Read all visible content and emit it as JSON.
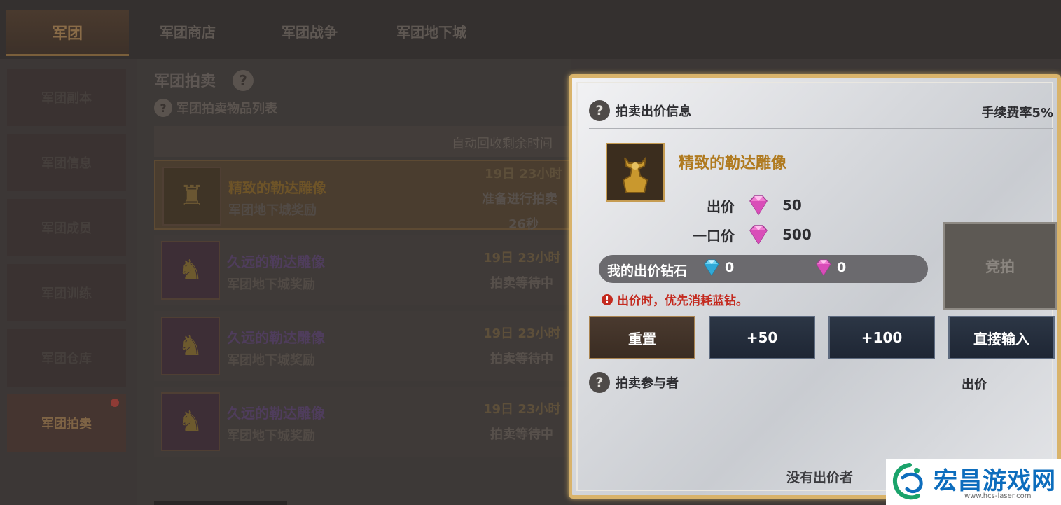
{
  "top_tabs": {
    "main": "军团",
    "shop": "军团商店",
    "war": "军团战争",
    "dungeon": "军团地下城"
  },
  "sidebar": {
    "items": [
      {
        "label": "军团副本"
      },
      {
        "label": "军团信息"
      },
      {
        "label": "军团成员"
      },
      {
        "label": "军团训练"
      },
      {
        "label": "军团仓库"
      },
      {
        "label": "军团拍卖"
      }
    ]
  },
  "auction_list": {
    "title": "军团拍卖",
    "subtitle": "军团拍卖物品列表",
    "column_header": "自动回收剩余时间",
    "rows": [
      {
        "name": "精致的勒达雕像",
        "source": "军团地下城奖励",
        "time": "19日 23小时",
        "status": "准备进行拍卖",
        "extra": "26秒"
      },
      {
        "name": "久远的勒达雕像",
        "source": "军团地下城奖励",
        "time": "19日 23小时",
        "status": "拍卖等待中"
      },
      {
        "name": "久远的勒达雕像",
        "source": "军团地下城奖励",
        "time": "19日 23小时",
        "status": "拍卖等待中"
      },
      {
        "name": "久远的勒达雕像",
        "source": "军团地下城奖励",
        "time": "19日 23小时",
        "status": "拍卖等待中"
      }
    ]
  },
  "bid_panel": {
    "header": "拍卖出价信息",
    "fee_rate": "手续费率5%",
    "item_name": "精致的勒达雕像",
    "bid_label": "出价",
    "bid_value": "50",
    "buyout_label": "一口价",
    "buyout_value": "500",
    "my_bid_label": "我的出价钻石",
    "blue_diamonds": "0",
    "pink_diamonds": "0",
    "warning": "出价时，优先消耗蓝钻。",
    "bid_button": "竞拍",
    "reset_button": "重置",
    "plus50_button": "+50",
    "plus100_button": "+100",
    "direct_input_button": "直接输入",
    "participants_header": "拍卖参与者",
    "participants_bid_col": "出价",
    "no_bidders": "没有出价者"
  },
  "watermark": {
    "title": "宏昌游戏网",
    "url": "www.hcs-laser.com"
  },
  "colors": {
    "panel_border": "#d9b36a",
    "item_name": "#b07a1f",
    "warning": "#c42a1f",
    "watermark_blue": "#0d6dbd"
  }
}
